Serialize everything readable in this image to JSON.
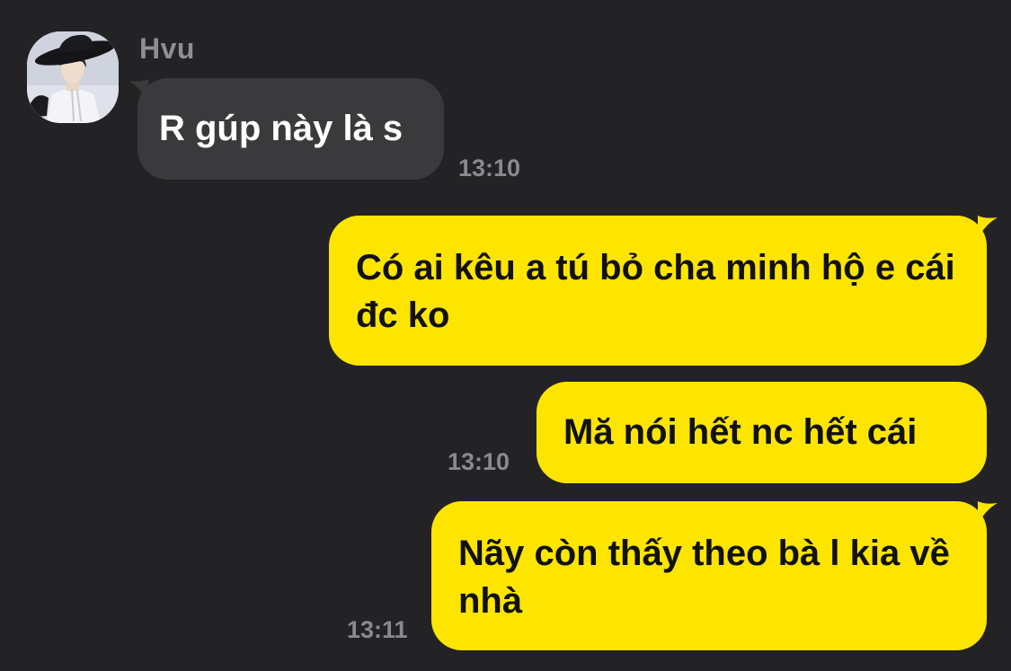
{
  "contact": {
    "name": "Hvu",
    "avatar_icon": "profile-photo-person-in-black-hat"
  },
  "colors": {
    "background": "#232325",
    "incoming_bubble": "#3a3a3c",
    "outgoing_bubble": "#fee500",
    "timestamp": "#8a8a8e"
  },
  "messages": [
    {
      "direction": "incoming",
      "text": "R gúp này là s",
      "time": "13:10"
    },
    {
      "direction": "outgoing",
      "text": "Có ai kêu a tú bỏ cha minh hộ e cái đc ko",
      "time": ""
    },
    {
      "direction": "outgoing",
      "text": "Mă nói hết nc hết cái",
      "time": "13:10"
    },
    {
      "direction": "outgoing",
      "text": "Nãy còn thấy theo bà l kia về nhà",
      "time": "13:11"
    }
  ]
}
